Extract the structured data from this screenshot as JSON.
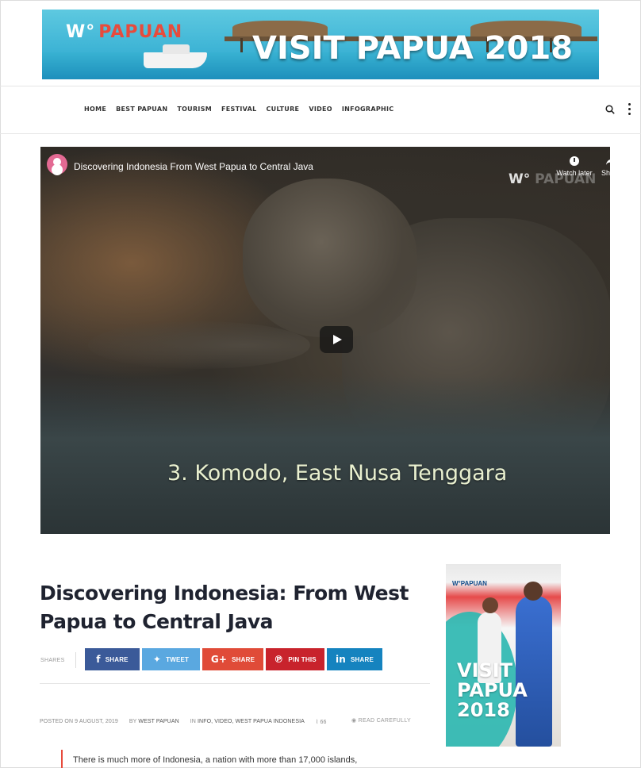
{
  "banner": {
    "brand": "PAPUAN",
    "title": "VISIT PAPUA 2018"
  },
  "nav": {
    "items": [
      "HOME",
      "BEST PAPUAN",
      "TOURISM",
      "FESTIVAL",
      "CULTURE",
      "VIDEO",
      "INFOGRAPHIC"
    ]
  },
  "video": {
    "title": "Discovering Indonesia From West Papua to Central Java",
    "watermark": "PAPUAN",
    "watch_later": "Watch later",
    "share": "Share",
    "caption": "3. Komodo, East Nusa Tenggara"
  },
  "article": {
    "title": "Discovering Indonesia: From West Papua to Central Java",
    "shares_label": "SHARES",
    "share_buttons": {
      "facebook": "SHARE",
      "twitter": "TWEET",
      "google": "SHARE",
      "pinterest": "PIN THIS",
      "linkedin": "SHARE"
    },
    "meta": {
      "posted": "POSTED ON 9 AUGUST, 2019",
      "by": "BY",
      "author": "WEST PAPUAN",
      "in": "IN",
      "categories": "INFO, VIDEO, WEST PAPUA INDONESIA",
      "views": "66",
      "read_label": "READ CAREFULLY"
    },
    "body_first_line": "There is much more of Indonesia, a nation with more than 17,000 islands,"
  },
  "ad": {
    "brand": "PAPUAN",
    "title": "VISIT PAPUA 2018"
  },
  "colors": {
    "accent": "#e74b3c",
    "facebook": "#3b5a99",
    "twitter": "#5aa8e0",
    "google": "#e04b38",
    "pinterest": "#c8232c",
    "linkedin": "#1583bf"
  }
}
